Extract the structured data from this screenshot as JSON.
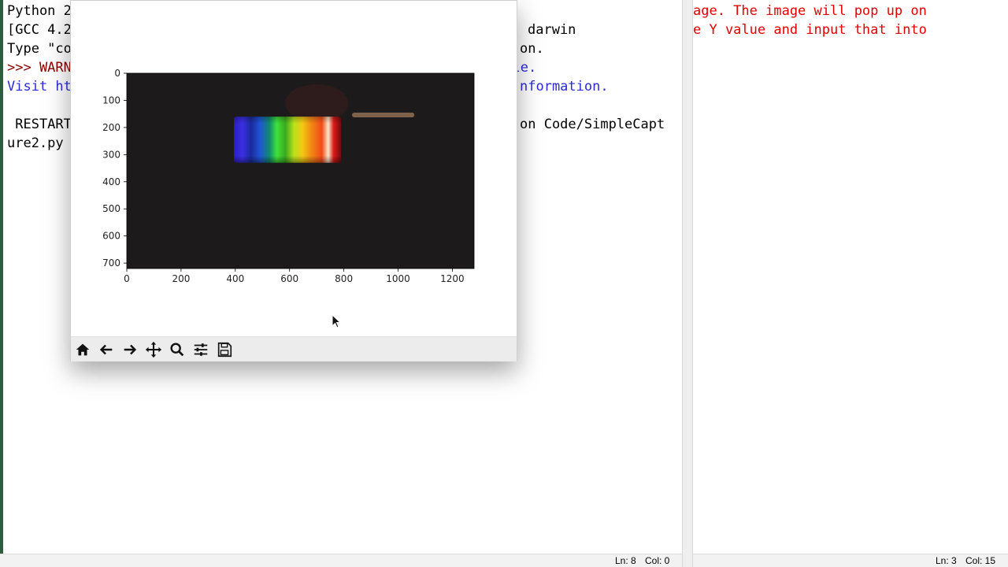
{
  "shell": {
    "lines": [
      {
        "text": "Python 2",
        "color": "black"
      },
      {
        "text": "[GCC 4.2",
        "color": "black"
      },
      {
        "text": "Type \"co",
        "color": "black"
      },
      {
        "text": ">>> WARN",
        "color": "prompt"
      },
      {
        "text": "Visit ht",
        "color": "blue"
      },
      {
        "text": "",
        "color": "black"
      },
      {
        "text": " RESTART",
        "color": "black"
      },
      {
        "text": "ure2.py",
        "color": "black"
      }
    ],
    "right_fragments": [
      {
        "text": "darwin"
      },
      {
        "text": "on."
      },
      {
        "text": "able."
      },
      {
        "text": "nformation."
      },
      {
        "text": "on Code/SimpleCapt"
      }
    ],
    "status": {
      "ln": "Ln: 8",
      "col": "Col: 0"
    }
  },
  "editor": {
    "lines": [
      "age. The image will pop up on",
      "e Y value and input that into"
    ],
    "status": {
      "ln": "Ln: 3",
      "col": "Col: 15"
    }
  },
  "figure": {
    "toolbar": [
      {
        "name": "home-button",
        "icon": "home-icon"
      },
      {
        "name": "back-button",
        "icon": "arrow-left-icon"
      },
      {
        "name": "forward-button",
        "icon": "arrow-right-icon"
      },
      {
        "name": "pan-button",
        "icon": "move-icon"
      },
      {
        "name": "zoom-button",
        "icon": "magnifier-icon"
      },
      {
        "name": "subplots-button",
        "icon": "sliders-icon"
      },
      {
        "name": "save-button",
        "icon": "floppy-icon"
      }
    ],
    "image": {
      "background": "#1c1a1a",
      "spectrum_colors": [
        "#3a2bd0",
        "#2c3ae0",
        "#1f6fd9",
        "#13b66d",
        "#5ce22b",
        "#c6e31a",
        "#f7d414",
        "#f79214",
        "#f3431a",
        "#e11a1a"
      ]
    }
  },
  "chart_data": {
    "type": "image",
    "x_ticks": [
      0,
      200,
      400,
      600,
      800,
      1000,
      1200
    ],
    "y_ticks": [
      0,
      100,
      200,
      300,
      400,
      500,
      600,
      700
    ],
    "xlim": [
      0,
      1280
    ],
    "ylim": [
      720,
      0
    ]
  }
}
